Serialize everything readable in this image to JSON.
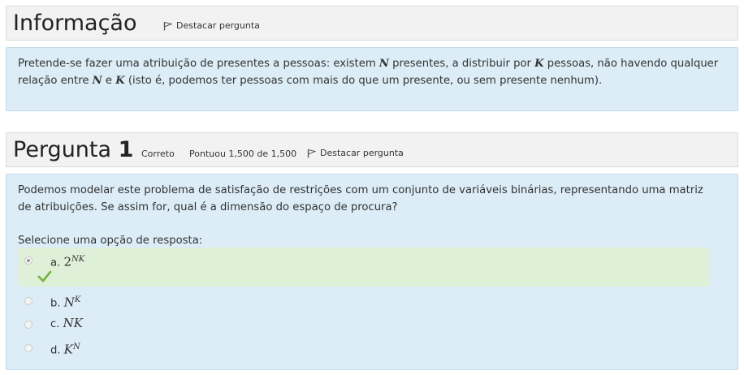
{
  "info": {
    "title": "Informação",
    "flag_label": "Destacar pergunta",
    "text_1": "Pretende-se fazer uma atribuição de presentes a pessoas: existem ",
    "var_n": "N",
    "text_2": " presentes, a distribuir por ",
    "var_k": "K",
    "text_3": " pessoas, não havendo qualquer",
    "text_4": "relação entre ",
    "text_5": " e ",
    "text_6": " (isto é, podemos ter pessoas com mais do que um presente, ou sem presente nenhum)."
  },
  "question": {
    "title_prefix": "Pergunta",
    "number": "1",
    "status": "Correto",
    "score": "Pontuou 1,500 de 1,500",
    "flag_label": "Destacar pergunta",
    "text_line1": "Podemos modelar este problema de satisfação de restrições com um conjunto de variáveis binárias, representando uma matriz",
    "text_line2": "de atribuições. Se assim for, qual é a dimensão do espaço de procura?",
    "prompt": "Selecione uma opção de resposta:",
    "options": [
      {
        "letter": "a.",
        "base": "2",
        "exp": "NK",
        "checked": true
      },
      {
        "letter": "b.",
        "base": "N",
        "exp": "K",
        "checked": false
      },
      {
        "letter": "c.",
        "base": "NK",
        "exp": "",
        "checked": false
      },
      {
        "letter": "d.",
        "base": "K",
        "exp": "N",
        "checked": false
      }
    ]
  },
  "colors": {
    "panel_bg": "#dcedf7",
    "correct_bg": "#dff0d8",
    "check": "#7cb342",
    "header_bg": "#f2f2f2"
  }
}
